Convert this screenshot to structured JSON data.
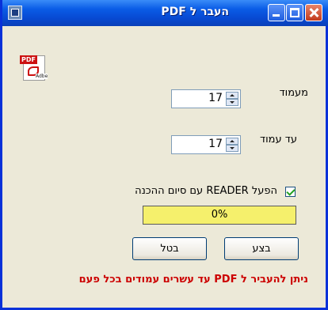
{
  "window": {
    "title": "העבר ל PDF"
  },
  "form": {
    "from_page": {
      "label": "מעמוד",
      "value": "17"
    },
    "to_page": {
      "label": "עד עמוד",
      "value": "17"
    },
    "open_reader": {
      "label": "הפעל READER עם סיום ההכנה",
      "checked": true
    }
  },
  "progress": {
    "text": "0%",
    "fraction": 0
  },
  "buttons": {
    "execute": "בצע",
    "cancel": "בטל"
  },
  "note": "ניתן להעביר ל PDF עד עשרים עמודים בכל פעם",
  "colors": {
    "title_bar": "#0a5ce6",
    "progress_bg": "#f5f06c",
    "note": "#cc0000"
  }
}
